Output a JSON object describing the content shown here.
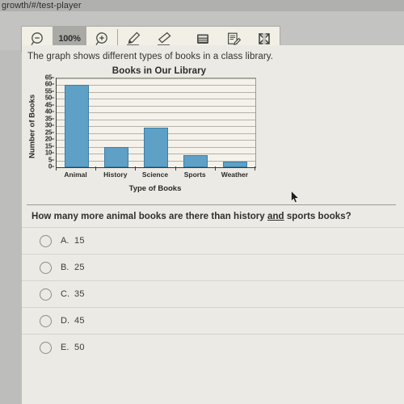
{
  "browser": {
    "url": "growth/#/test-player"
  },
  "toolbar": {
    "zoom_out_icon": "zoom-out-icon",
    "zoom_level": "100%",
    "zoom_in_icon": "zoom-in-icon",
    "highlighter_icon": "highlighter-pen-icon",
    "eraser_icon": "eraser-icon",
    "calculator_icon": "calculator-icon",
    "notepad_icon": "notepad-annotate-icon",
    "strikethrough_icon": "answer-eliminator-icon"
  },
  "passage": {
    "intro": "The graph shows different types of books in a class library."
  },
  "chart_data": {
    "type": "bar",
    "title": "Books in Our Library",
    "xlabel": "Type of Books",
    "ylabel": "Number of Books",
    "categories": [
      "Animal",
      "History",
      "Science",
      "Sports",
      "Weather"
    ],
    "values": [
      60,
      15,
      29,
      9,
      4
    ],
    "ylim": [
      0,
      65
    ],
    "ytick_step": 5,
    "yticks": [
      65,
      60,
      55,
      50,
      45,
      40,
      35,
      30,
      25,
      20,
      15,
      10,
      5,
      0
    ],
    "grid": true,
    "legend": "none",
    "bar_color": "#5fa0c6",
    "bar_edge_color": "#3c7ea6"
  },
  "question": {
    "text_before": "How many more animal books are there than history ",
    "text_underlined": "and",
    "text_after": " sports books?",
    "options": [
      {
        "letter": "A.",
        "text": "15"
      },
      {
        "letter": "B.",
        "text": "25"
      },
      {
        "letter": "C.",
        "text": "35"
      },
      {
        "letter": "D.",
        "text": "45"
      },
      {
        "letter": "E.",
        "text": "50"
      }
    ]
  }
}
